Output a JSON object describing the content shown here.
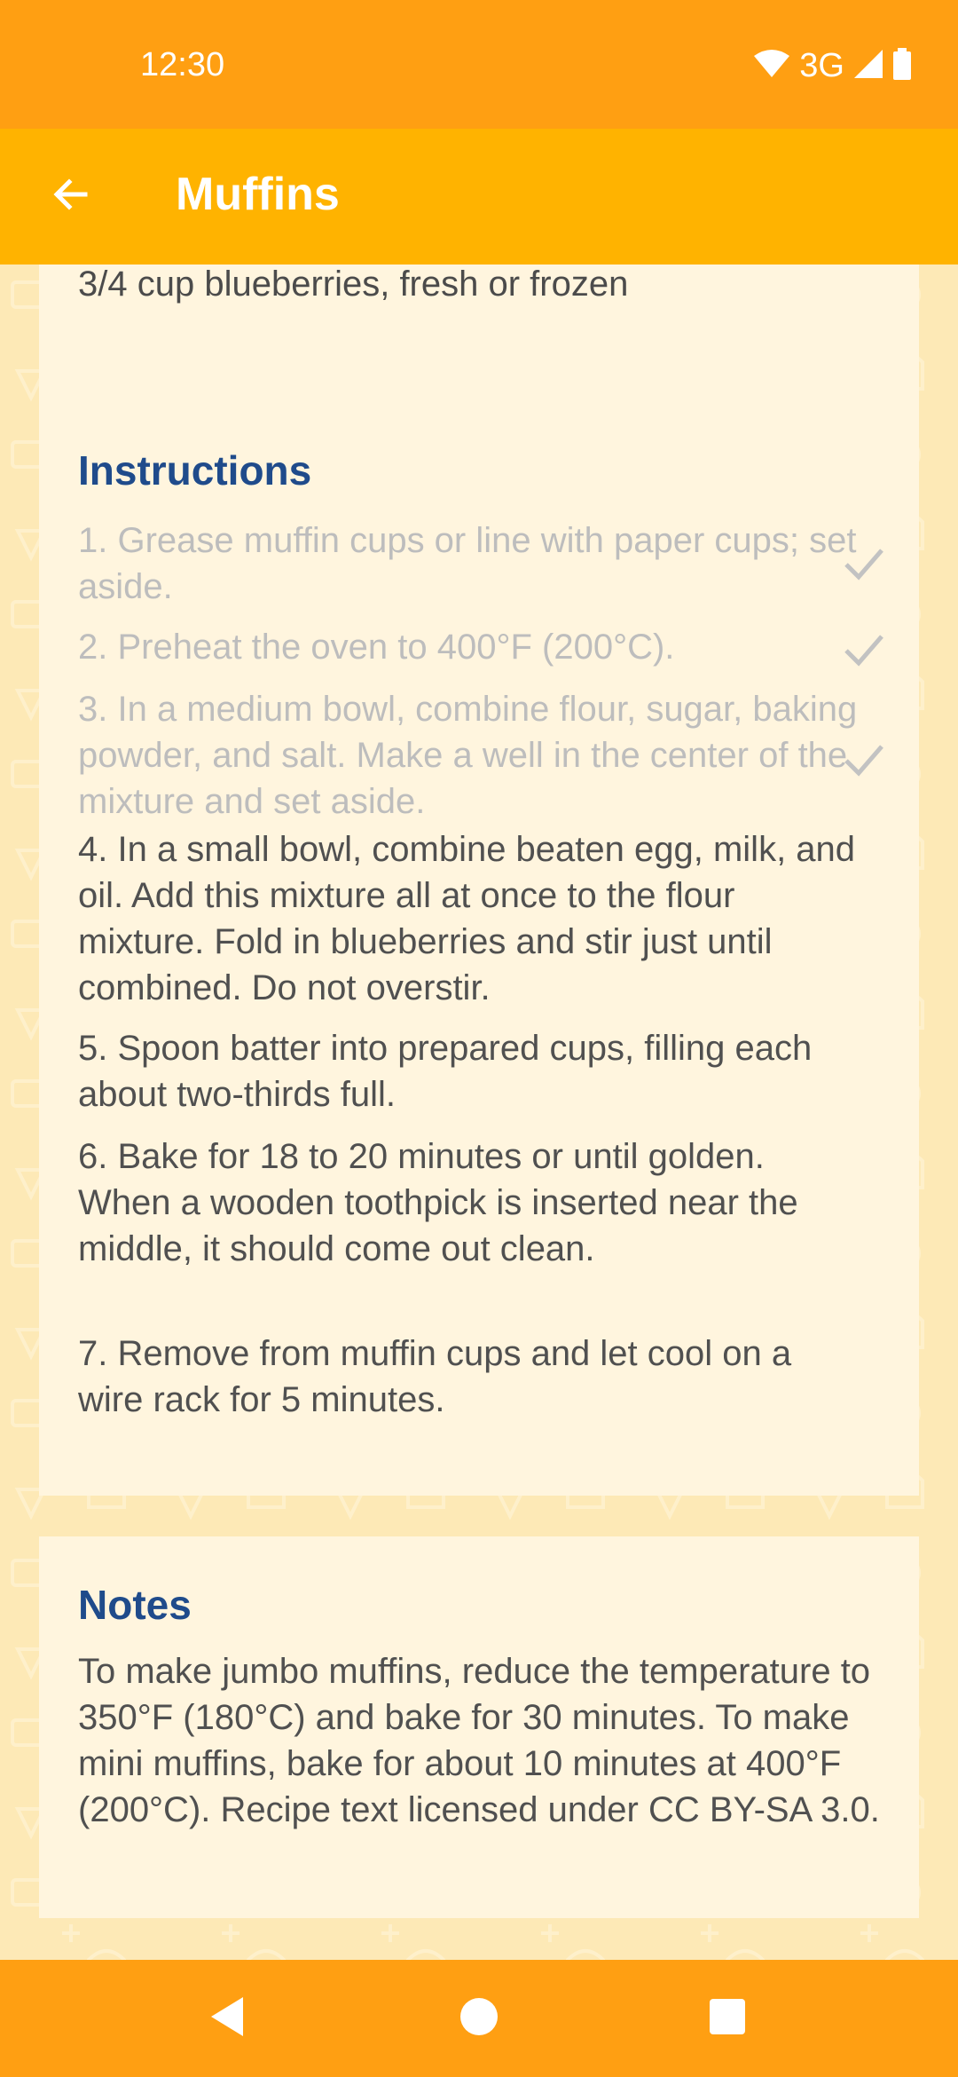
{
  "status_bar": {
    "time": "12:30",
    "network": "3G"
  },
  "app_bar": {
    "title": "Muffins"
  },
  "ingredients": {
    "last_item": "3/4 cup blueberries, fresh or frozen"
  },
  "instructions": {
    "heading": "Instructions",
    "steps": [
      {
        "text": "1. Grease muffin cups or line with paper cups; set aside.",
        "done": true
      },
      {
        "text": "2. Preheat the oven to 400°F (200°C).",
        "done": true
      },
      {
        "text": "3. In a medium bowl, combine flour, sugar, baking powder, and salt. Make a well in the center of the mixture and set aside.",
        "done": true
      },
      {
        "text": "4. In a small bowl, combine beaten egg, milk, and oil. Add this mixture all at once to the flour mixture. Fold in blueberries and stir just until combined. Do not overstir.",
        "done": false
      },
      {
        "text": "5. Spoon batter into prepared cups, filling each about two-thirds full.",
        "done": false
      },
      {
        "text": "6. Bake for 18 to 20 minutes or until golden. When a wooden toothpick is inserted near the middle, it should come out clean.",
        "done": false
      },
      {
        "text": "7. Remove from muffin cups and let cool on a wire rack for 5 minutes.",
        "done": false
      }
    ]
  },
  "notes": {
    "heading": "Notes",
    "text": "To make jumbo muffins, reduce the temperature to 350°F (180°C) and bake for 30 minutes. To make mini muffins, bake for about 10 minutes at 400°F (200°C). Recipe text licensed under CC BY-SA 3.0."
  },
  "colors": {
    "status_bar": "#ff9f12",
    "app_bar": "#ffb300",
    "heading": "#1f4b8b",
    "card": "#fff5de",
    "background": "#fde9b6"
  },
  "icons": {
    "back": "arrow-left-icon",
    "check": "check-icon",
    "wifi": "wifi-icon",
    "signal": "signal-icon",
    "battery": "battery-icon",
    "nav_back": "triangle-back-icon",
    "nav_home": "circle-home-icon",
    "nav_recents": "square-recents-icon"
  }
}
